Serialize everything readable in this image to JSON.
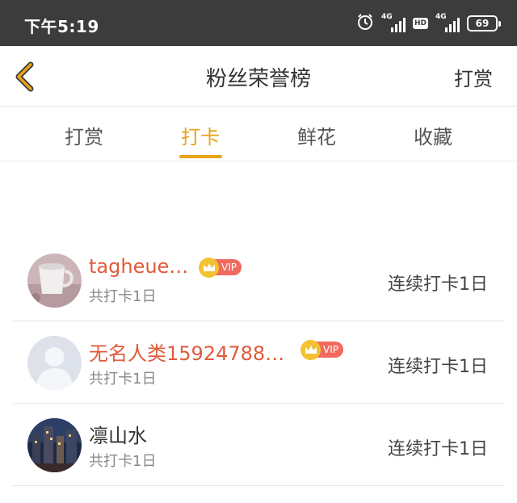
{
  "status_bar": {
    "time": "下午5:19",
    "signal_1_label": "4G",
    "hd_label": "HD",
    "signal_2_label": "4G",
    "battery": "69",
    "icons": [
      "alarm-icon",
      "signal-icon",
      "hd-icon",
      "signal-icon",
      "battery-icon"
    ]
  },
  "header": {
    "title": "粉丝荣誉榜",
    "action_label": "打赏",
    "back_icon": "chevron-left-icon",
    "accent_color": "#e8a317"
  },
  "tabs": [
    {
      "label": "打赏",
      "active": false
    },
    {
      "label": "打卡",
      "active": true
    },
    {
      "label": "鲜花",
      "active": false
    },
    {
      "label": "收藏",
      "active": false
    }
  ],
  "fans": [
    {
      "name": "tagheue…",
      "vip": true,
      "vip_label": "VIP",
      "total": "共打卡1日",
      "streak": "连续打卡1日",
      "avatar": "mug-photo"
    },
    {
      "name": "无名人类15924788…",
      "vip": true,
      "vip_label": "VIP",
      "total": "共打卡1日",
      "streak": "连续打卡1日",
      "avatar": "default-person"
    },
    {
      "name": "凛山水",
      "vip": false,
      "total": "共打卡1日",
      "streak": "连续打卡1日",
      "avatar": "night-city-photo"
    }
  ]
}
